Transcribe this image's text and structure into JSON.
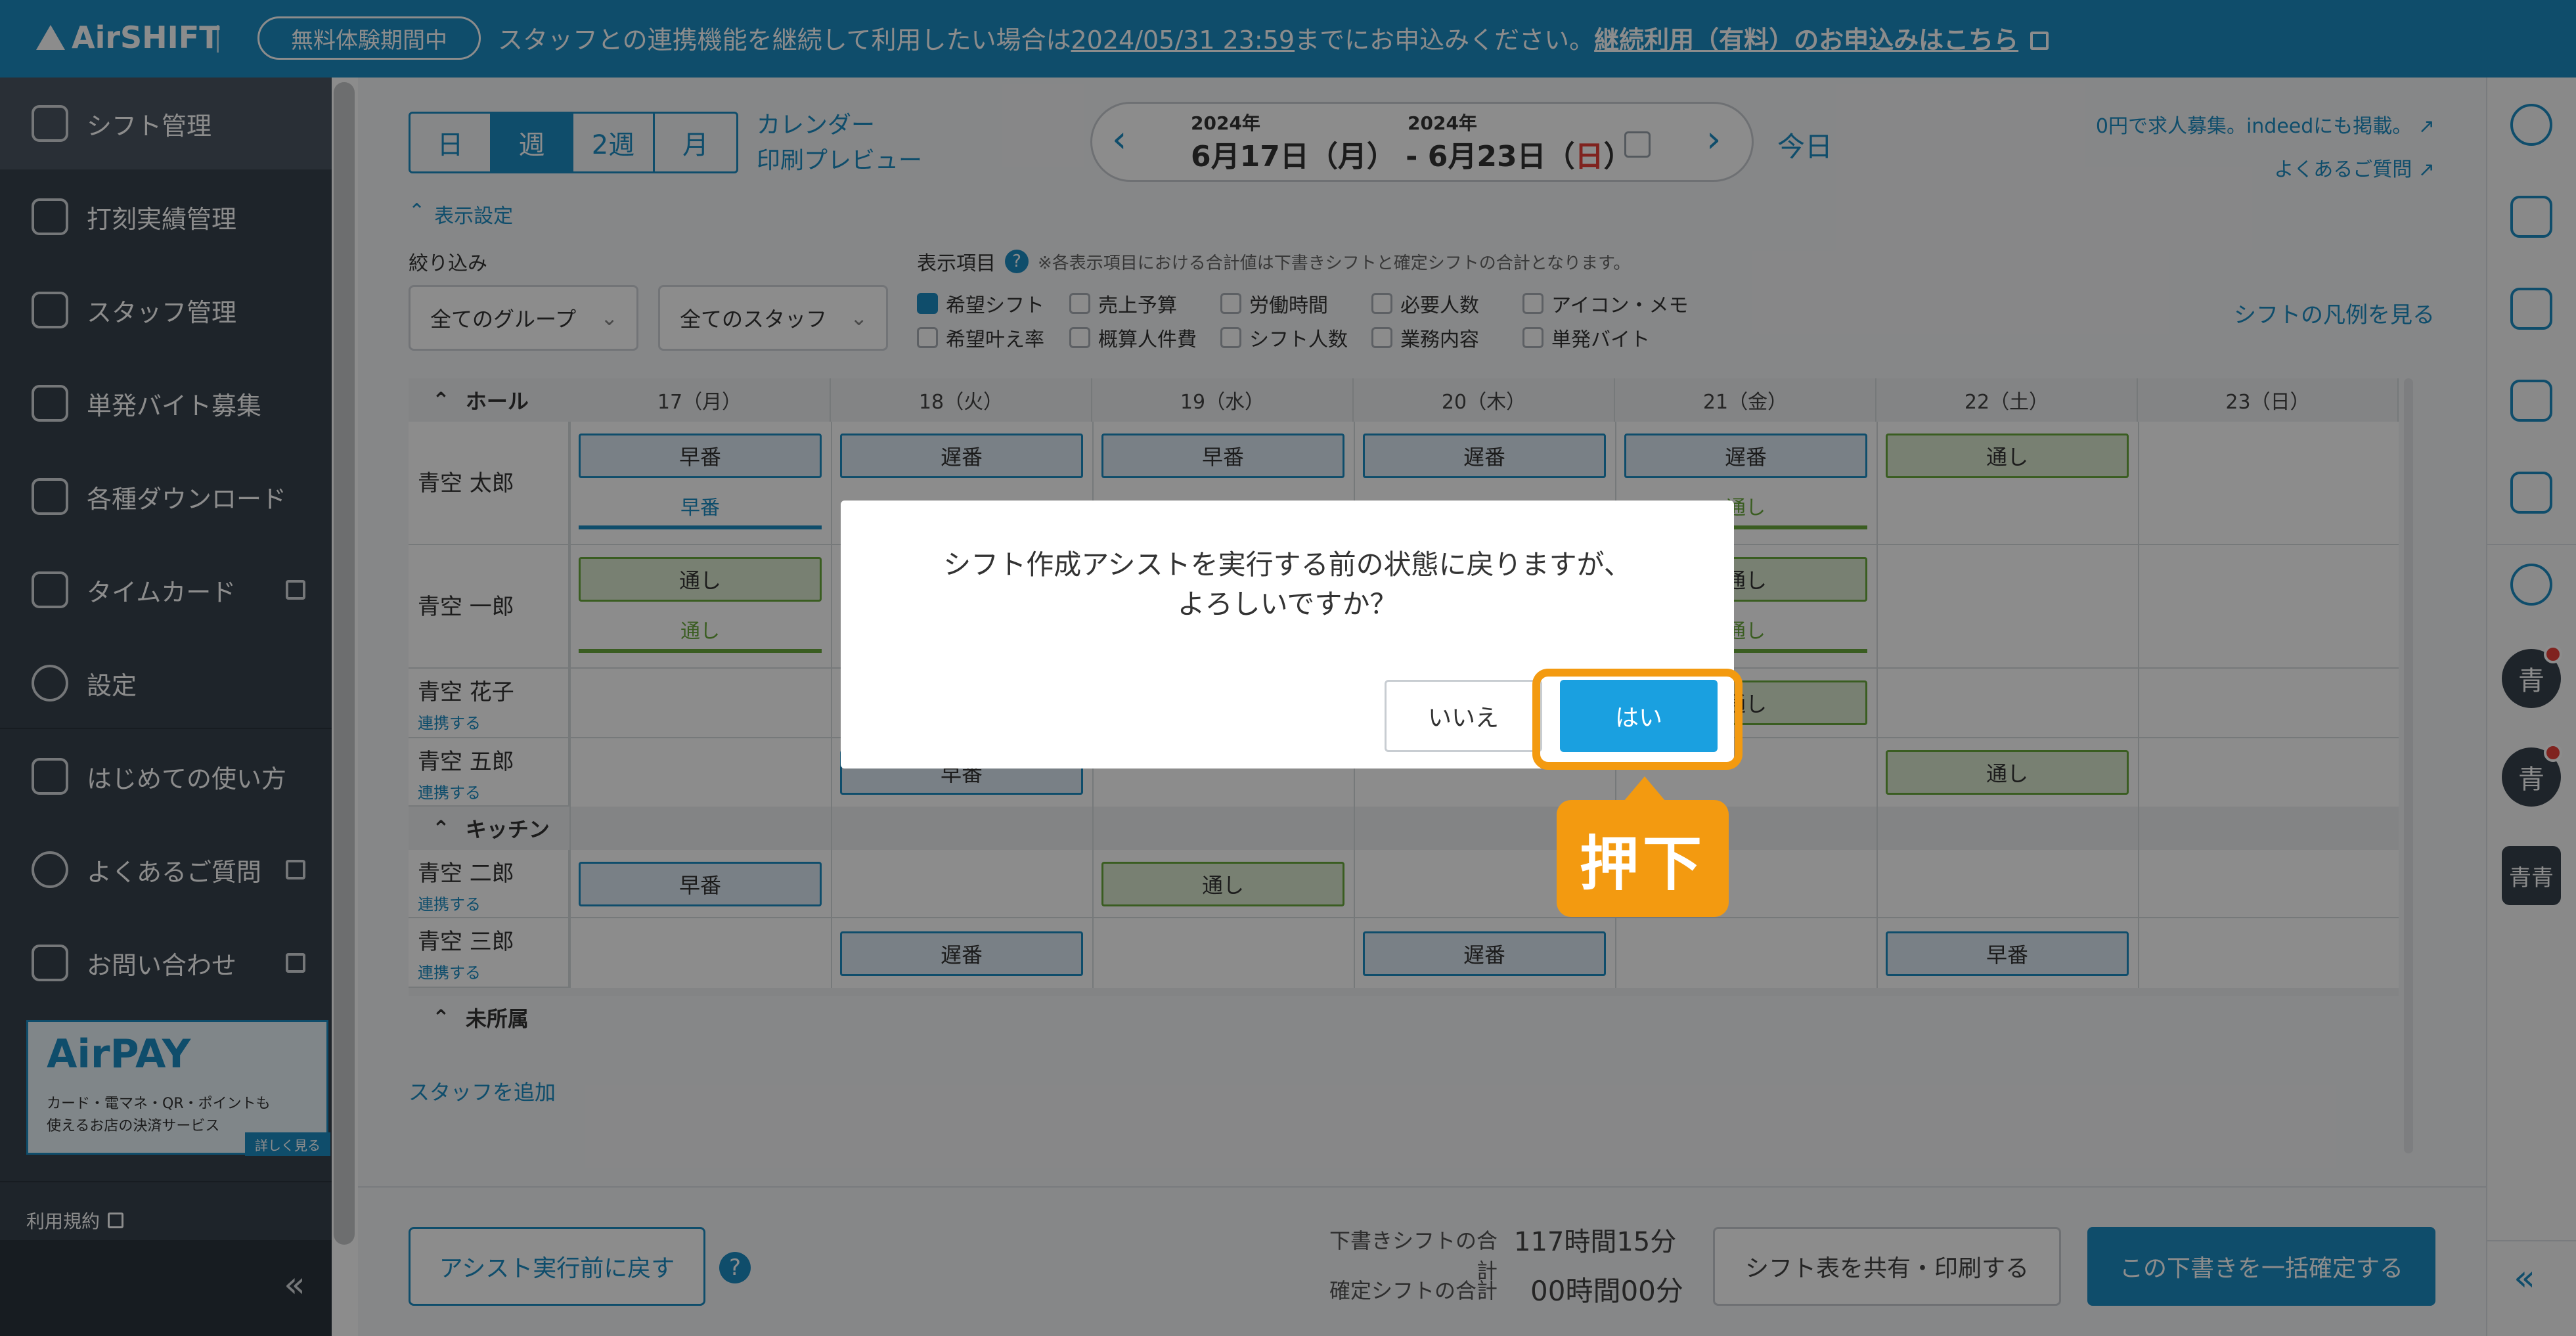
{
  "topbar": {
    "logo": "AirSHIFT",
    "trial_badge": "無料体験期間中",
    "notice_text": "スタッフとの連携機能を継続して利用したい場合は",
    "notice_date": "2024/05/31 23:59",
    "notice_after": "までにお申込みください。",
    "notice_link": "継続利用（有料）のお申込みはこちら"
  },
  "sidebar": {
    "items": [
      {
        "label": "シフト管理",
        "icon": "shift-icon"
      },
      {
        "label": "打刻実績管理",
        "icon": "timesheet-icon"
      },
      {
        "label": "スタッフ管理",
        "icon": "staff-icon"
      },
      {
        "label": "単発バイト募集",
        "icon": "search-person-icon"
      },
      {
        "label": "各種ダウンロード",
        "icon": "download-icon"
      },
      {
        "label": "タイムカード",
        "icon": "timecard-icon"
      },
      {
        "label": "設定",
        "icon": "gear-icon"
      },
      {
        "label": "はじめての使い方",
        "icon": "guide-icon"
      },
      {
        "label": "よくあるご質問",
        "icon": "question-icon"
      },
      {
        "label": "お問い合わせ",
        "icon": "mail-icon"
      }
    ],
    "ad_title": "AirPAY",
    "ad_line1": "カード・電マネ・QR・ポイントも",
    "ad_line2": "使えるお店の決済サービス",
    "ad_more": "詳しく見る",
    "terms": "利用規約",
    "collapse": "«"
  },
  "toolbar": {
    "view_tabs": [
      "日",
      "週",
      "2週",
      "月"
    ],
    "calendar_label": "カレンダー",
    "print_preview": "印刷プレビュー",
    "start_year": "2024年",
    "end_year": "2024年",
    "date_range_start": "6月17日（月）",
    "date_range_sep": " - ",
    "date_range_end_a": "6月23日（",
    "date_range_end_day": "日",
    "date_range_end_b": "）",
    "today": "今日",
    "indeed_link": "0円で求人募集。indeedにも掲載。",
    "faq_link": "よくあるご質問"
  },
  "filters": {
    "display_settings": "表示設定",
    "narrow_label": "絞り込み",
    "group_select": "全てのグループ",
    "staff_select": "全てのスタッフ",
    "display_items_label": "表示項目",
    "display_note": "※各表示項目における合計値は下書きシフトと確定シフトの合計となります。",
    "checkboxes": [
      {
        "label": "希望シフト",
        "checked": true
      },
      {
        "label": "売上予算",
        "checked": false
      },
      {
        "label": "労働時間",
        "checked": false
      },
      {
        "label": "必要人数",
        "checked": false
      },
      {
        "label": "アイコン・メモ",
        "checked": false
      },
      {
        "label": "希望叶え率",
        "checked": false
      },
      {
        "label": "概算人件費",
        "checked": false
      },
      {
        "label": "シフト人数",
        "checked": false
      },
      {
        "label": "業務内容",
        "checked": false
      },
      {
        "label": "単発バイト",
        "checked": false
      }
    ],
    "legend_link": "シフトの凡例を見る"
  },
  "grid": {
    "days": [
      "17（月）",
      "18（火）",
      "19（水）",
      "20（木）",
      "21（金）",
      "22（土）",
      "23（日）"
    ],
    "sections": {
      "hall": "ホール",
      "kitchen": "キッチン",
      "unassigned": "未所属"
    },
    "link_label": "連携する",
    "staff": [
      {
        "name": "青空 太郎",
        "shifts": [
          "早番",
          "遅番",
          "早番",
          "遅番",
          "遅番",
          "通し",
          ""
        ],
        "wish": [
          "早番",
          "",
          "",
          "",
          "通し",
          "",
          ""
        ]
      },
      {
        "name": "青空 一郎",
        "shifts": [
          "通し",
          "",
          "",
          "",
          "通し",
          "",
          ""
        ],
        "wish": [
          "通し",
          "",
          "",
          "",
          "通し",
          "",
          ""
        ]
      },
      {
        "name": "青空 花子",
        "shifts": [
          "",
          "",
          "",
          "",
          "通し",
          "",
          ""
        ]
      },
      {
        "name": "青空 五郎",
        "shifts": [
          "",
          "早番",
          "",
          "",
          "",
          "通し",
          ""
        ]
      },
      {
        "name": "青空 二郎",
        "shifts": [
          "早番",
          "",
          "通し",
          "",
          "",
          "",
          ""
        ]
      },
      {
        "name": "青空 三郎",
        "shifts": [
          "",
          "遅番",
          "",
          "遅番",
          "",
          "早番",
          ""
        ]
      }
    ],
    "add_staff": "スタッフを追加"
  },
  "bottom": {
    "revert_button": "アシスト実行前に戻す",
    "draft_label": "下書きシフトの合計",
    "draft_value": "117時間15分",
    "confirmed_label": "確定シフトの合計",
    "confirmed_value": "00時間00分",
    "share_button": "シフト表を共有・印刷する",
    "confirm_button": "この下書きを一括確定する"
  },
  "right_rail": {
    "avatar_char": "青",
    "avatar_pair": "青青"
  },
  "dialog": {
    "message_line1": "シフト作成アシストを実行する前の状態に戻りますが、",
    "message_line2": "よろしいですか？",
    "no": "いいえ",
    "yes": "はい"
  },
  "annotation": {
    "callout": "押下",
    "color": "#f39a10"
  },
  "colors": {
    "brand": "#1d8cc4",
    "sidebar": "#37424d",
    "wish_green": "#6aaa3c",
    "sunday_red": "#e9403a"
  }
}
